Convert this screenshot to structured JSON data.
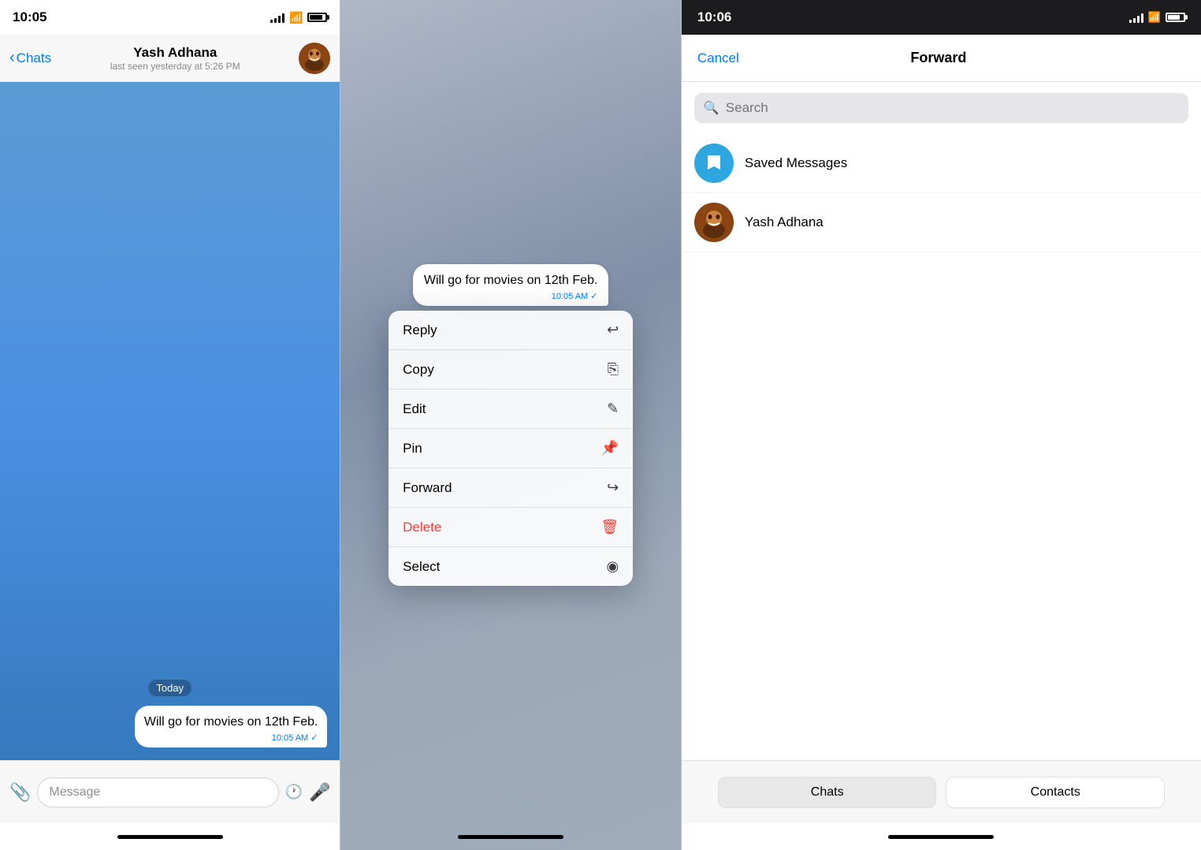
{
  "panel1": {
    "status_time": "10:05",
    "back_label": "Chats",
    "contact_name": "Yash Adhana",
    "contact_status": "last seen yesterday at 5:26 PM",
    "date_separator": "Today",
    "message_text": "Will go for movies on 12th Feb.",
    "message_time": "10:05 AM",
    "input_placeholder": "Message"
  },
  "panel2": {
    "message_text": "Will go for movies on 12th Feb.",
    "message_time": "10:05 AM",
    "menu_items": [
      {
        "label": "Reply",
        "icon": "↩",
        "color": "normal"
      },
      {
        "label": "Copy",
        "icon": "⎘",
        "color": "normal"
      },
      {
        "label": "Edit",
        "icon": "✎",
        "color": "normal"
      },
      {
        "label": "Pin",
        "icon": "⚲",
        "color": "normal"
      },
      {
        "label": "Forward",
        "icon": "↪",
        "color": "normal"
      },
      {
        "label": "Delete",
        "icon": "🗑",
        "color": "delete"
      },
      {
        "label": "Select",
        "icon": "◉",
        "color": "normal"
      }
    ]
  },
  "panel3": {
    "status_time": "10:06",
    "cancel_label": "Cancel",
    "title": "Forward",
    "search_placeholder": "Search",
    "contacts": [
      {
        "name": "Saved Messages",
        "type": "saved"
      },
      {
        "name": "Yash Adhana",
        "type": "contact"
      }
    ],
    "tab_chats": "Chats",
    "tab_contacts": "Contacts"
  }
}
